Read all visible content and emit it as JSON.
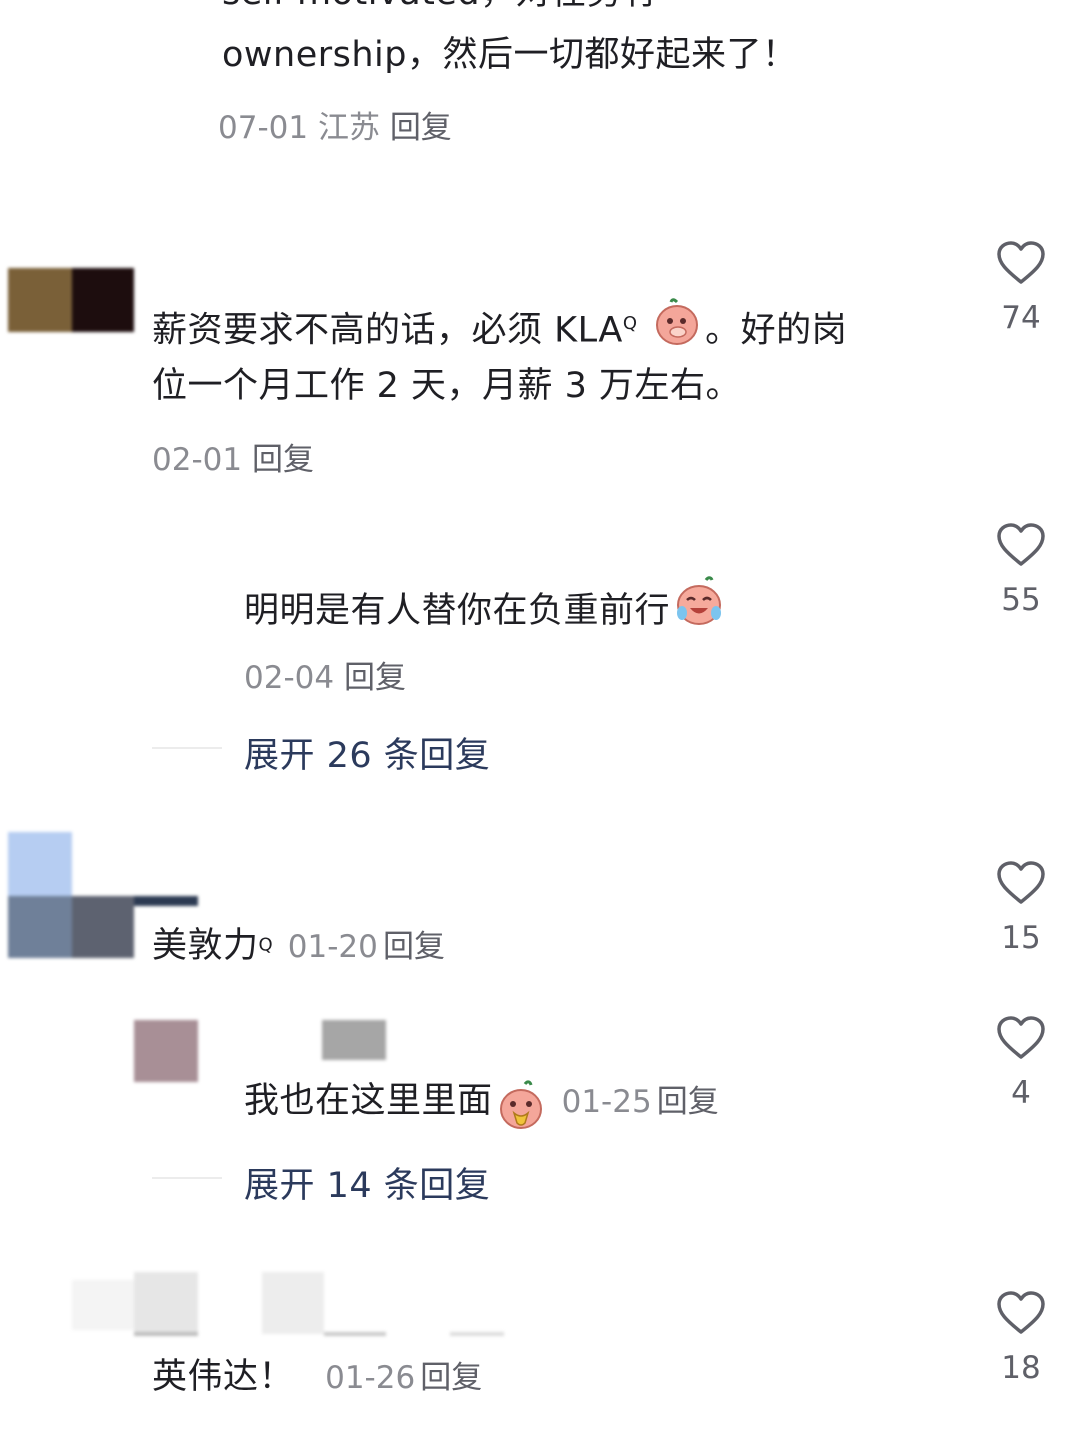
{
  "c0": {
    "line1": "self-motivated，对任务有",
    "line2": "ownership，然后一切都好起来了！",
    "date": "07-01",
    "location": "江苏",
    "reply": "回复"
  },
  "c1": {
    "line1_a": "薪资要求不高的话，必须 KLA",
    "line1_tag": "Q",
    "line1_b": "。好的岗",
    "line2": "位一个月工作 2 天，月薪 3 万左右。",
    "date": "02-01",
    "reply": "回复",
    "likes": "74",
    "emoji": "covering-mouth-sticker"
  },
  "c1r": {
    "text": "明明是有人替你在负重前行",
    "date": "02-04",
    "reply": "回复",
    "likes": "55",
    "emoji": "crying-laugh-sticker"
  },
  "expand1": {
    "label": "展开 26 条回复"
  },
  "c2": {
    "name": "美敦力",
    "tag": "Q",
    "date": "01-20",
    "reply": "回复",
    "likes": "15"
  },
  "c2r": {
    "text": "我也在这里里面",
    "date": "01-25",
    "reply": "回复",
    "likes": "4",
    "emoji": "shy-sticker"
  },
  "expand2": {
    "label": "展开 14 条回复"
  },
  "c3": {
    "text": "英伟达！",
    "date": "01-26",
    "reply": "回复",
    "likes": "18"
  },
  "colors": {
    "accent_link": "#2b3a5c",
    "meta_gray": "#8a8b91",
    "heart_outline": "#5f6068"
  }
}
